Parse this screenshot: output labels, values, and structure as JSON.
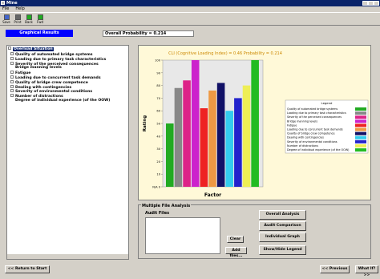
{
  "window": {
    "title": "Mine"
  },
  "menu": [
    "File",
    "Help"
  ],
  "toolbar": [
    {
      "label": "Save",
      "icon": "save-icon",
      "color": "#4466cc"
    },
    {
      "label": "Print",
      "icon": "print-icon",
      "color": "#666666"
    },
    {
      "label": "Back",
      "icon": "back-icon",
      "color": "#22aa22"
    },
    {
      "label": "Fwd",
      "icon": "forward-icon",
      "color": "#22aa22"
    }
  ],
  "graphical_results_label": "Graphical Results",
  "overall_probability": "Overall Probability = 0.214",
  "tree": {
    "root": "Overload Situation",
    "items": [
      {
        "label": "Quality of automated bridge systems",
        "expandable": true
      },
      {
        "label": "Loading due to primary task characteristics",
        "expandable": true
      },
      {
        "label": "Severity of the perceived consequences",
        "expandable": true
      },
      {
        "label": "Bridge manning levels",
        "expandable": false
      },
      {
        "label": "Fatigue",
        "expandable": true
      },
      {
        "label": "Loading due to concurrent task demands",
        "expandable": true
      },
      {
        "label": "Quality of bridge crew competence",
        "expandable": true
      },
      {
        "label": "Dealing with contingencies",
        "expandable": true
      },
      {
        "label": "Severity of environmental conditions",
        "expandable": true
      },
      {
        "label": "Number of distractions",
        "expandable": true
      },
      {
        "label": "Degree of individual experience (of the OOW)",
        "expandable": false
      }
    ]
  },
  "chart_data": {
    "type": "bar",
    "title": "CLI (Cognitive Loading Index) = 0.46  Probability = 0.214",
    "xlabel": "Factor",
    "ylabel": "Rating",
    "ylim": [
      0,
      100
    ],
    "yticks": [
      "N/A 0",
      "10",
      "20",
      "30",
      "40",
      "50",
      "60",
      "70",
      "80",
      "90",
      "100"
    ],
    "legend_title": "Legend",
    "legend_position": "right",
    "bars": [
      {
        "name": "Quality of automated bridge systems",
        "value": 50,
        "color": "#22aa22"
      },
      {
        "name": "Loading due to primary task characteristics",
        "value": 78,
        "color": "#888888"
      },
      {
        "name": "Severity of the perceived consequences",
        "value": 84,
        "color": "#dd2288"
      },
      {
        "name": "Bridge manning levels",
        "value": 100,
        "color": "#cc22cc"
      },
      {
        "name": "Fatigue",
        "value": 62,
        "color": "#ee2222"
      },
      {
        "name": "Loading due to concurrent task demands",
        "value": 76,
        "color": "#ee9944"
      },
      {
        "name": "Quality of bridge crew competence",
        "value": 82,
        "color": "#111166"
      },
      {
        "name": "Dealing with contingencies",
        "value": 60,
        "color": "#33ccee"
      },
      {
        "name": "Severity of environmental conditions",
        "value": 70,
        "color": "#2222cc"
      },
      {
        "name": "Number of distractions",
        "value": 80,
        "color": "#eeee55"
      },
      {
        "name": "Degree of individual experience (of the OOW)",
        "value": 100,
        "color": "#22bb22"
      }
    ]
  },
  "multiple_file_analysis": {
    "title": "Multiple File Analysis",
    "audit_files_label": "Audit Files",
    "clear_label": "Clear",
    "add_files_label": "Add files...",
    "overall_analysis_label": "Overall Analysis",
    "audit_comparison_label": "Audit Comparison",
    "individual_graph_label": "Individual Graph",
    "show_hide_legend_label": "Show/Hide Legend"
  },
  "footer": {
    "return_label": "<< Return to Start",
    "previous_label": "<< Previous",
    "whatif_label": "What If? >>"
  }
}
